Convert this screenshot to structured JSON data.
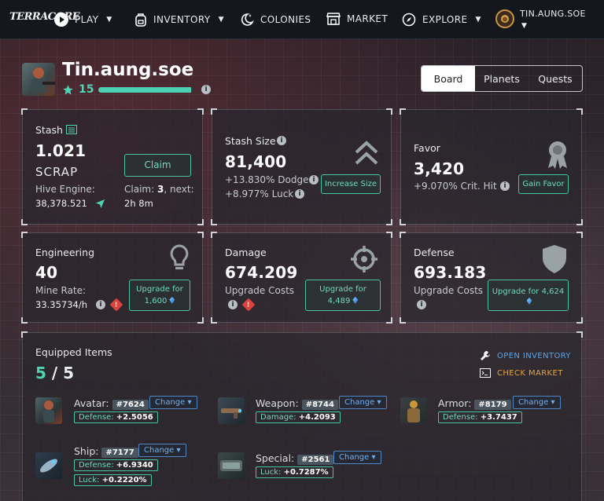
{
  "nav": {
    "logo": "TERRACORE",
    "play": "PLAY",
    "inventory": "INVENTORY",
    "colonies": "COLONIES",
    "market": "MARKET",
    "explore": "EXPLORE",
    "user": "TIN.AUNG.SOE"
  },
  "profile": {
    "name": "Tin.aung.soe",
    "level": "15",
    "level_progress": 0.98
  },
  "tabs": [
    "Board",
    "Planets",
    "Quests"
  ],
  "cards": {
    "stash": {
      "title": "Stash",
      "value": "1.021",
      "unit": "SCRAP",
      "hive_label": "Hive Engine:",
      "hive_value": "38,378.521",
      "claim_button": "Claim",
      "claim_label": "Claim:",
      "claim_count": "3",
      "next_label": ", next:",
      "next_value": "2h 8m"
    },
    "stash_size": {
      "title": "Stash Size",
      "value": "81,400",
      "dodge": "+13.830% Dodge",
      "luck": "+8.977% Luck",
      "button": "Increase Size"
    },
    "favor": {
      "title": "Favor",
      "value": "3,420",
      "crit": "+9.070% Crit. Hit",
      "button": "Gain Favor"
    },
    "engineering": {
      "title": "Engineering",
      "value": "40",
      "mine_label": "Mine Rate:",
      "mine_value": "33.35734/h",
      "button_line1": "Upgrade for",
      "button_cost": "1,600"
    },
    "damage": {
      "title": "Damage",
      "value": "674.209",
      "costs_label": "Upgrade Costs",
      "button_line1": "Upgrade for",
      "button_cost": "4,489"
    },
    "defense": {
      "title": "Defense",
      "value": "693.183",
      "costs_label": "Upgrade Costs",
      "button_line1": "Upgrade for",
      "button_cost": "4,624"
    }
  },
  "equipped": {
    "title": "Equipped Items",
    "current": "5",
    "separator": "/",
    "total": "5",
    "open_inventory": "OPEN INVENTORY",
    "check_market": "CHECK MARKET",
    "items": [
      {
        "name": "Avatar:",
        "id": "#7624",
        "change": "Change",
        "stats": [
          {
            "label": "Defense:",
            "value": "+2.5056"
          }
        ]
      },
      {
        "name": "Weapon:",
        "id": "#8744",
        "change": "Change",
        "stats": [
          {
            "label": "Damage:",
            "value": "+4.2093"
          }
        ]
      },
      {
        "name": "Armor:",
        "id": "#8179",
        "change": "Change",
        "stats": [
          {
            "label": "Defense:",
            "value": "+3.7437"
          }
        ]
      },
      {
        "name": "Ship:",
        "id": "#7177",
        "change": "Change",
        "stats": [
          {
            "label": "Defense:",
            "value": "+6.9340"
          },
          {
            "label": "Luck:",
            "value": "+0.2220%"
          }
        ]
      },
      {
        "name": "Special:",
        "id": "#2561",
        "change": "Change",
        "stats": [
          {
            "label": "Luck:",
            "value": "+0.7287%"
          }
        ]
      }
    ]
  },
  "colors": {
    "accent": "#4fd4b3",
    "link_blue": "#5aa6e6",
    "market_orange": "#e8a23a",
    "warning_red": "#d8433e"
  }
}
